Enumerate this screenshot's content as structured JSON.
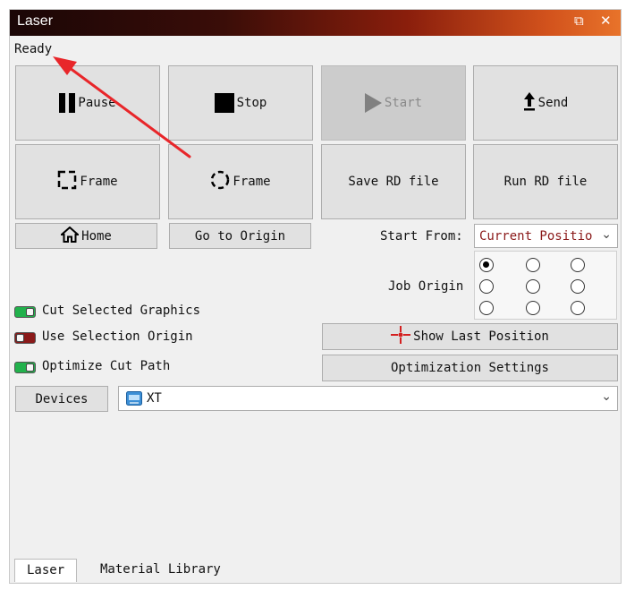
{
  "window": {
    "title": "Laser",
    "restore_icon": "⧉",
    "close_icon": "✕"
  },
  "status": "Ready",
  "buttons": {
    "pause": "Pause",
    "stop": "Stop",
    "start": "Start",
    "send": "Send",
    "frame_rect": "Frame",
    "frame_circle": "Frame",
    "save_rd": "Save RD file",
    "run_rd": "Run RD file",
    "home": "Home",
    "go_origin": "Go to Origin",
    "show_last": "Show Last Position",
    "opt_settings": "Optimization Settings",
    "devices": "Devices"
  },
  "start_from": {
    "label": "Start From:",
    "value": "Current Positio"
  },
  "job_origin": {
    "label": "Job Origin",
    "selected_index": 0
  },
  "options": {
    "cut_selected": {
      "label": "Cut Selected Graphics",
      "on": true
    },
    "use_origin": {
      "label": "Use Selection Origin",
      "on": false
    },
    "optimize": {
      "label": "Optimize Cut Path",
      "on": true
    }
  },
  "device_select": {
    "value": "XT"
  },
  "tabs": [
    "Laser",
    "Material Library"
  ],
  "colors": {
    "annotation_arrow": "#e8262a",
    "toggle_on": "#22b14c",
    "toggle_off": "#8a1a1a"
  }
}
